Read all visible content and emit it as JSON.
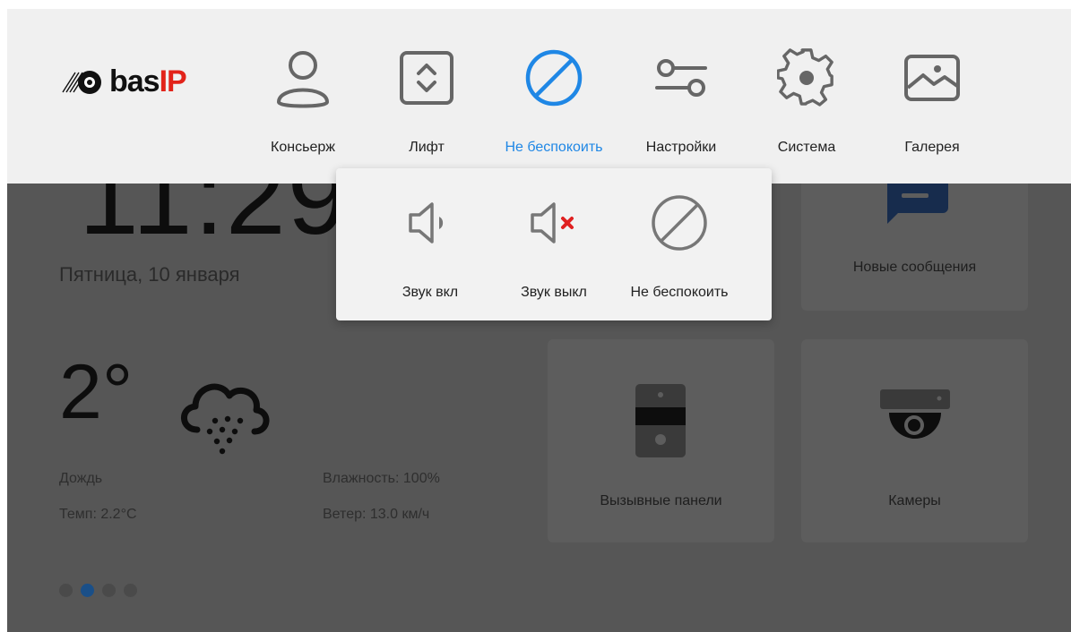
{
  "home": {
    "time": "11:29",
    "date": "Пятница, 10 января",
    "temperature": "2°",
    "weather_condition": "Дождь",
    "temp_detail": "Темп: 2.2°C",
    "humidity": "Влажность: 100%",
    "wind": "Ветер: 13.0 км/ч",
    "page_dots": 4,
    "active_dot": 1
  },
  "tiles": [
    {
      "label": "Новые сообщения",
      "icon": "message-icon"
    },
    {
      "label": "Вызывные панели",
      "icon": "call-panel-icon"
    },
    {
      "label": "Камеры",
      "icon": "camera-icon"
    }
  ],
  "logo": {
    "brand": "bas",
    "suffix": "IP"
  },
  "nav": {
    "items": [
      {
        "label": "Консьерж",
        "icon": "person-icon"
      },
      {
        "label": "Лифт",
        "icon": "elevator-icon"
      },
      {
        "label": "Не беспокоить",
        "icon": "do-not-disturb-icon",
        "active": true
      },
      {
        "label": "Настройки",
        "icon": "sliders-icon"
      },
      {
        "label": "Система",
        "icon": "gear-icon"
      },
      {
        "label": "Галерея",
        "icon": "gallery-icon"
      }
    ]
  },
  "popover": {
    "items": [
      {
        "label": "Звук вкл",
        "icon": "sound-on-icon"
      },
      {
        "label": "Звук выкл",
        "icon": "sound-off-icon"
      },
      {
        "label": "Не беспокоить",
        "icon": "do-not-disturb-icon"
      }
    ]
  },
  "colors": {
    "accent": "#1f87e5",
    "brand_red": "#e2231a",
    "mute_red": "#e02020",
    "active_dot": "#1a4f88",
    "overlay_bg": "#565656"
  }
}
